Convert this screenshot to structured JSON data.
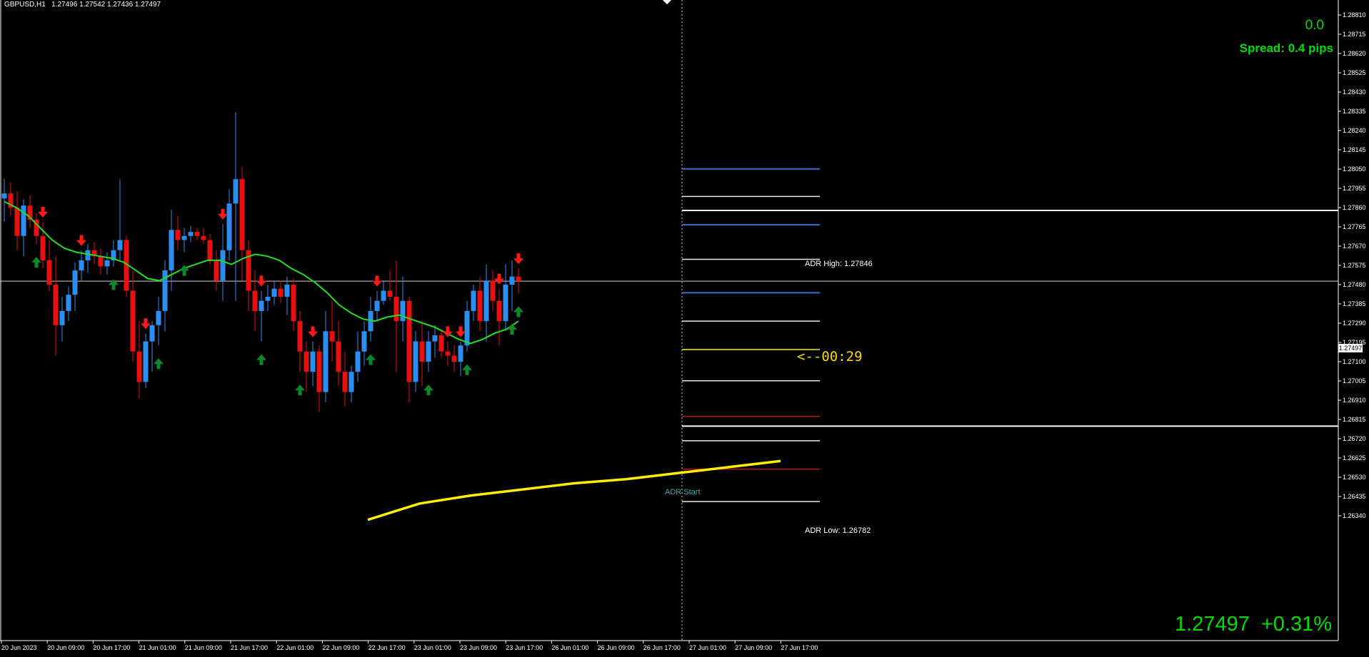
{
  "header": {
    "symbol": "GBPUSD,H1",
    "ohlc": "1.27496 1.27542 1.27436 1.27497"
  },
  "indicators": {
    "top_value": "0.0",
    "spread": "Spread: 0.4 pips",
    "current_price": "1.27497",
    "change_percent": "+0.31%",
    "countdown": "<--00:29",
    "adr_high": "ADR High: 1.27846",
    "adr_low": "ADR Low: 1.26782",
    "adr_start": "ADR Start"
  },
  "price_axis": {
    "current_price_tag": "1.27497",
    "ticks": [
      "1.28810",
      "1.28715",
      "1.28620",
      "1.28525",
      "1.28430",
      "1.28335",
      "1.28240",
      "1.28145",
      "1.28050",
      "1.27955",
      "1.27860",
      "1.27765",
      "1.27670",
      "1.27575",
      "1.27480",
      "1.27385",
      "1.27290",
      "1.27195",
      "1.27100",
      "1.27005",
      "1.26910",
      "1.26815",
      "1.26720",
      "1.26625",
      "1.26530",
      "1.26435",
      "1.26340"
    ]
  },
  "time_axis": {
    "ticks": [
      "20 Jun 2023",
      "20 Jun 09:00",
      "20 Jun 17:00",
      "21 Jun 01:00",
      "21 Jun 09:00",
      "21 Jun 17:00",
      "22 Jun 01:00",
      "22 Jun 09:00",
      "22 Jun 17:00",
      "23 Jun 01:00",
      "23 Jun 09:00",
      "23 Jun 17:00",
      "26 Jun 01:00",
      "26 Jun 09:00",
      "26 Jun 17:00",
      "27 Jun 01:00",
      "27 Jun 09:00",
      "27 Jun 17:00"
    ]
  },
  "colors": {
    "background": "#000000",
    "bull_candle": "#2b8ef0",
    "bear_candle": "#e81010",
    "moving_average": "#22dd22",
    "long_trend": "#ffee00",
    "adr_lines": "#ffffff",
    "pivot_blue": "#3a6ed8",
    "signal_up": "#0a8a2a",
    "signal_down": "#ff1a1a",
    "text_green": "#00dd00"
  },
  "chart_data": {
    "type": "candlestick",
    "symbol": "GBPUSD",
    "timeframe": "H1",
    "ylim": [
      1.263,
      1.289
    ],
    "last": 1.27497,
    "ohlc": [
      [
        1.27905,
        1.28002,
        1.2779,
        1.2793
      ],
      [
        1.2793,
        1.27985,
        1.2782,
        1.2786
      ],
      [
        1.2786,
        1.2794,
        1.2765,
        1.2772
      ],
      [
        1.2772,
        1.279,
        1.2762,
        1.2787
      ],
      [
        1.2787,
        1.2792,
        1.2776,
        1.278
      ],
      [
        1.278,
        1.2783,
        1.2768,
        1.2772
      ],
      [
        1.2772,
        1.2779,
        1.2756,
        1.276
      ],
      [
        1.276,
        1.277,
        1.2745,
        1.2748
      ],
      [
        1.2748,
        1.2762,
        1.2713,
        1.2728
      ],
      [
        1.2728,
        1.2742,
        1.272,
        1.2735
      ],
      [
        1.2735,
        1.2747,
        1.273,
        1.2743
      ],
      [
        1.2743,
        1.2759,
        1.2735,
        1.2755
      ],
      [
        1.2755,
        1.2765,
        1.275,
        1.276
      ],
      [
        1.276,
        1.2768,
        1.2754,
        1.2765
      ],
      [
        1.2765,
        1.2769,
        1.2758,
        1.2762
      ],
      [
        1.2762,
        1.2766,
        1.2753,
        1.2757
      ],
      [
        1.2757,
        1.2764,
        1.2753,
        1.276
      ],
      [
        1.276,
        1.277,
        1.2757,
        1.2765
      ],
      [
        1.2765,
        1.28,
        1.276,
        1.277
      ],
      [
        1.277,
        1.2772,
        1.2742,
        1.2745
      ],
      [
        1.2745,
        1.2755,
        1.271,
        1.2715
      ],
      [
        1.2715,
        1.273,
        1.2692,
        1.27
      ],
      [
        1.27,
        1.2724,
        1.2697,
        1.272
      ],
      [
        1.272,
        1.273,
        1.2705,
        1.2728
      ],
      [
        1.2728,
        1.2742,
        1.2718,
        1.2735
      ],
      [
        1.2735,
        1.276,
        1.2725,
        1.2755
      ],
      [
        1.2755,
        1.2785,
        1.2745,
        1.2775
      ],
      [
        1.2775,
        1.2782,
        1.2765,
        1.277
      ],
      [
        1.277,
        1.2776,
        1.2764,
        1.2772
      ],
      [
        1.2772,
        1.2777,
        1.2769,
        1.2774
      ],
      [
        1.2774,
        1.2776,
        1.277,
        1.2772
      ],
      [
        1.2772,
        1.2776,
        1.2768,
        1.277
      ],
      [
        1.277,
        1.2773,
        1.2758,
        1.276
      ],
      [
        1.276,
        1.2765,
        1.2745,
        1.275
      ],
      [
        1.275,
        1.2778,
        1.274,
        1.2765
      ],
      [
        1.2765,
        1.2795,
        1.276,
        1.2788
      ],
      [
        1.2788,
        1.2833,
        1.274,
        1.28
      ],
      [
        1.28,
        1.2806,
        1.275,
        1.2765
      ],
      [
        1.2765,
        1.277,
        1.2735,
        1.2745
      ],
      [
        1.2745,
        1.2755,
        1.2725,
        1.2735
      ],
      [
        1.2735,
        1.2745,
        1.272,
        1.274
      ],
      [
        1.274,
        1.2748,
        1.2735,
        1.2742
      ],
      [
        1.2742,
        1.275,
        1.2738,
        1.2746
      ],
      [
        1.2746,
        1.275,
        1.2739,
        1.2742
      ],
      [
        1.2742,
        1.2752,
        1.2733,
        1.2748
      ],
      [
        1.2748,
        1.2751,
        1.2725,
        1.273
      ],
      [
        1.273,
        1.2735,
        1.2705,
        1.2715
      ],
      [
        1.2715,
        1.272,
        1.2695,
        1.2705
      ],
      [
        1.2705,
        1.272,
        1.2698,
        1.2715
      ],
      [
        1.2715,
        1.2718,
        1.2685,
        1.2695
      ],
      [
        1.2695,
        1.2735,
        1.269,
        1.2725
      ],
      [
        1.2725,
        1.274,
        1.271,
        1.272
      ],
      [
        1.272,
        1.273,
        1.2698,
        1.2705
      ],
      [
        1.2705,
        1.2715,
        1.2688,
        1.2695
      ],
      [
        1.2695,
        1.2708,
        1.269,
        1.2705
      ],
      [
        1.2705,
        1.2725,
        1.27,
        1.2715
      ],
      [
        1.2715,
        1.273,
        1.2708,
        1.2725
      ],
      [
        1.2725,
        1.2742,
        1.272,
        1.2735
      ],
      [
        1.2735,
        1.2745,
        1.273,
        1.274
      ],
      [
        1.274,
        1.275,
        1.2738,
        1.2745
      ],
      [
        1.2745,
        1.2755,
        1.274,
        1.2742
      ],
      [
        1.2742,
        1.276,
        1.2705,
        1.273
      ],
      [
        1.273,
        1.2752,
        1.272,
        1.274
      ],
      [
        1.274,
        1.2742,
        1.269,
        1.27
      ],
      [
        1.27,
        1.2725,
        1.2695,
        1.272
      ],
      [
        1.272,
        1.273,
        1.2698,
        1.271
      ],
      [
        1.271,
        1.2725,
        1.2705,
        1.272
      ],
      [
        1.272,
        1.2728,
        1.2712,
        1.2723
      ],
      [
        1.2723,
        1.2726,
        1.2712,
        1.2715
      ],
      [
        1.2715,
        1.272,
        1.2708,
        1.2713
      ],
      [
        1.2713,
        1.2718,
        1.2705,
        1.271
      ],
      [
        1.271,
        1.272,
        1.2703,
        1.2718
      ],
      [
        1.2718,
        1.274,
        1.2715,
        1.2735
      ],
      [
        1.2735,
        1.2748,
        1.273,
        1.2745
      ],
      [
        1.2745,
        1.2752,
        1.2725,
        1.273
      ],
      [
        1.273,
        1.2758,
        1.272,
        1.275
      ],
      [
        1.275,
        1.2755,
        1.2735,
        1.274
      ],
      [
        1.274,
        1.2746,
        1.2718,
        1.273
      ],
      [
        1.273,
        1.2758,
        1.2725,
        1.2748
      ],
      [
        1.2748,
        1.276,
        1.2735,
        1.2752
      ],
      [
        1.2752,
        1.2756,
        1.27436,
        1.27497
      ]
    ],
    "moving_average": [
      1.2789,
      1.2786,
      1.2782,
      1.2776,
      1.277,
      1.2766,
      1.2764,
      1.2763,
      1.2762,
      1.2761,
      1.2759,
      1.2755,
      1.2751,
      1.275,
      1.2753,
      1.2756,
      1.2758,
      1.276,
      1.276,
      1.2758,
      1.2761,
      1.2763,
      1.2762,
      1.276,
      1.2756,
      1.2753,
      1.2749,
      1.2744,
      1.2738,
      1.2734,
      1.2731,
      1.273,
      1.2732,
      1.2733,
      1.2731,
      1.2729,
      1.2727,
      1.2724,
      1.2721,
      1.2719,
      1.2721,
      1.2724,
      1.2726,
      1.273
    ],
    "long_trend": [
      1.2632,
      1.264,
      1.2644,
      1.2647,
      1.265,
      1.2652,
      1.2655,
      1.2658,
      1.2661
    ],
    "adr": {
      "high": 1.27846,
      "low": 1.26782
    },
    "levels": {
      "blue": [
        1.28051,
        1.27775,
        1.2744
      ],
      "white": [
        1.27915,
        1.27605,
        1.273,
        1.27006,
        1.2671,
        1.2641
      ],
      "yellow": [
        1.2716
      ],
      "red": [
        1.2683,
        1.2657
      ]
    },
    "signals_up": [
      5,
      17,
      24,
      28,
      40,
      46,
      57,
      66,
      72,
      79,
      87,
      94,
      99
    ],
    "signals_down": [
      6,
      12,
      22,
      34,
      40,
      48,
      58,
      69,
      71,
      77,
      92
    ]
  }
}
